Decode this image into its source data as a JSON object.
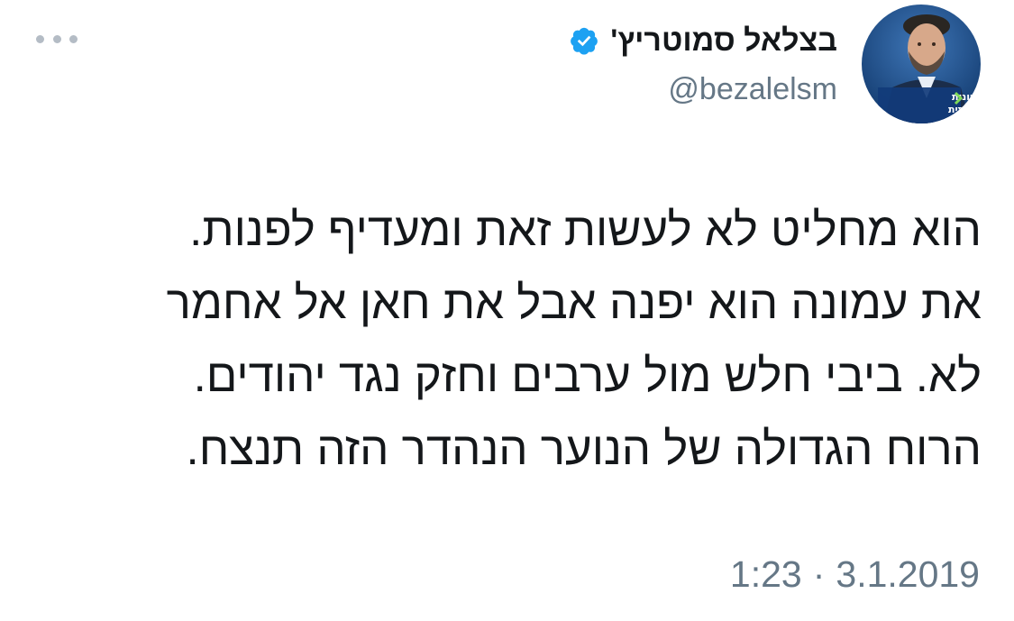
{
  "author": {
    "display_name": "בצלאל סמוטריץ'",
    "handle": "@bezalelsm",
    "verified": true,
    "avatar_badge_text": [
      "הציונות",
      "הדתית"
    ]
  },
  "tweet": {
    "lines": [
      "הוא מחליט לא לעשות זאת ומעדיף לפנות.",
      "את עמונה הוא יפנה אבל את חאן אל אחמר",
      "לא. ביבי חלש מול ערבים וחזק נגד יהודים.",
      "הרוח הגדולה של הנוער הנהדר הזה תנצח."
    ]
  },
  "meta": {
    "time": "1:23",
    "separator": "·",
    "date": "3.1.2019"
  },
  "colors": {
    "verified_badge": "#1da1f2",
    "text_primary": "#14171a",
    "text_secondary": "#657786",
    "more_dots": "#b4bcc5",
    "avatar_bg": "#1f4f8c",
    "badge_accent": "#7ed957"
  },
  "icons": {
    "more": "more-horizontal-icon",
    "verified": "verified-badge-icon"
  }
}
